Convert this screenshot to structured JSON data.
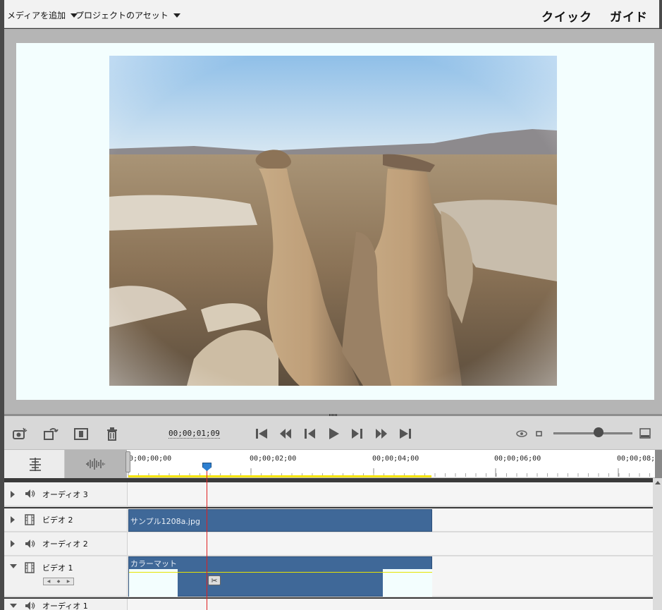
{
  "topbar": {
    "add_media": "メディアを追加",
    "project_assets": "プロジェクトのアセット",
    "mode_quick": "クイック",
    "mode_guided": "ガイド"
  },
  "transport": {
    "timecode": "00;00;01;09",
    "icons": [
      "camera-icon",
      "rotate-icon",
      "trim-icon",
      "trash-icon",
      "go-to-start-icon",
      "step-back-icon",
      "frame-back-icon",
      "play-icon",
      "frame-forward-icon",
      "step-forward-icon",
      "go-to-end-icon",
      "render-preview-icon"
    ]
  },
  "ruler": {
    "labels": [
      "0;00;00;00",
      "00;00;02;00",
      "00;00;04;00",
      "00;00;06;00",
      "00;00;08;0"
    ]
  },
  "tracks": [
    {
      "name": "オーディオ 3",
      "type": "audio",
      "expanded": false
    },
    {
      "name": "ビデオ 2",
      "type": "video",
      "expanded": false,
      "clip": "サンプル1208a.jpg"
    },
    {
      "name": "オーディオ 2",
      "type": "audio",
      "expanded": false
    },
    {
      "name": "ビデオ 1",
      "type": "video",
      "expanded": true,
      "clip": "カラーマット"
    },
    {
      "name": "オーディオ 1",
      "type": "audio",
      "expanded": true
    }
  ],
  "colors": {
    "clip": "#3f6898",
    "playhead": "#e02020",
    "work_area": "#f5e400"
  }
}
